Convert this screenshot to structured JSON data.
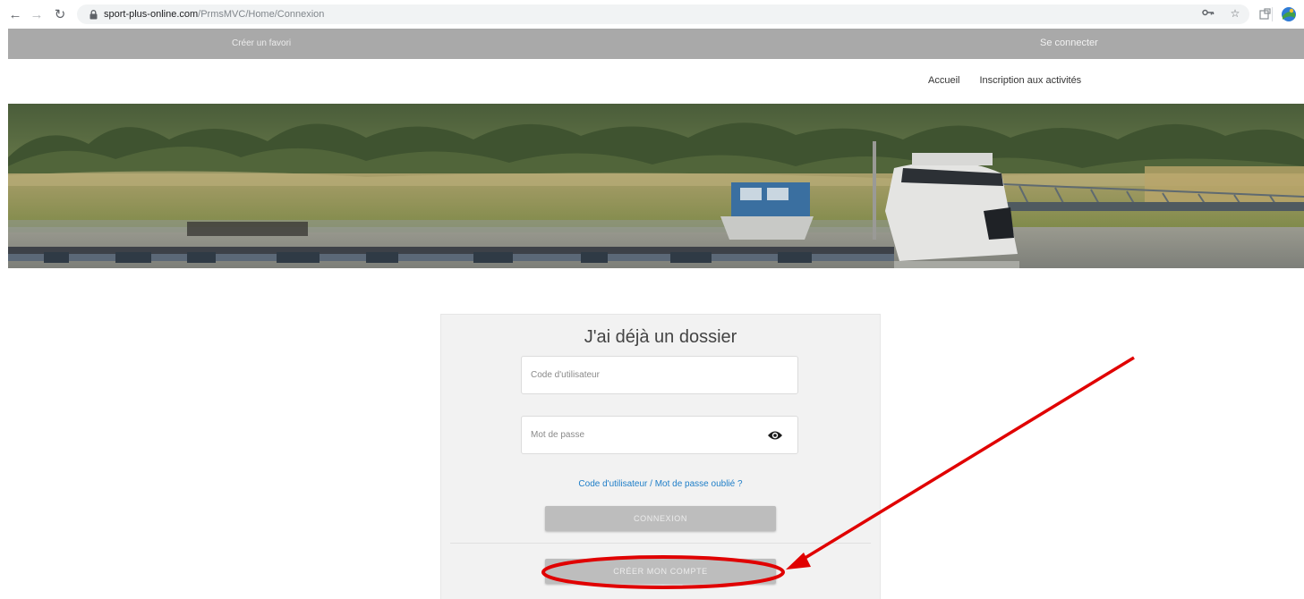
{
  "browser": {
    "url_host": "sport-plus-online.com",
    "url_path": "/PrmsMVC/Home/Connexion"
  },
  "topbar": {
    "left_link": "Créer un favori",
    "right_link": "Se connecter"
  },
  "nav": {
    "items": [
      "Accueil",
      "Inscription aux activités"
    ]
  },
  "login": {
    "title": "J'ai déjà un dossier",
    "user_placeholder": "Code d'utilisateur",
    "password_placeholder": "Mot de passe",
    "forgot_link": "Code d'utilisateur / Mot de passe oublié ?",
    "connexion_button": "CONNEXION",
    "create_account_button": "CRÉER MON COMPTE"
  },
  "colors": {
    "topbar": "#a9a9a9",
    "link_blue": "#1e7ec8",
    "button_grey": "#bdbdbd",
    "annotation_red": "#e00000"
  },
  "icons": [
    "back-arrow-icon",
    "forward-arrow-icon",
    "reload-icon",
    "lock-icon",
    "key-icon",
    "star-icon",
    "extension-icon",
    "eye-icon"
  ]
}
